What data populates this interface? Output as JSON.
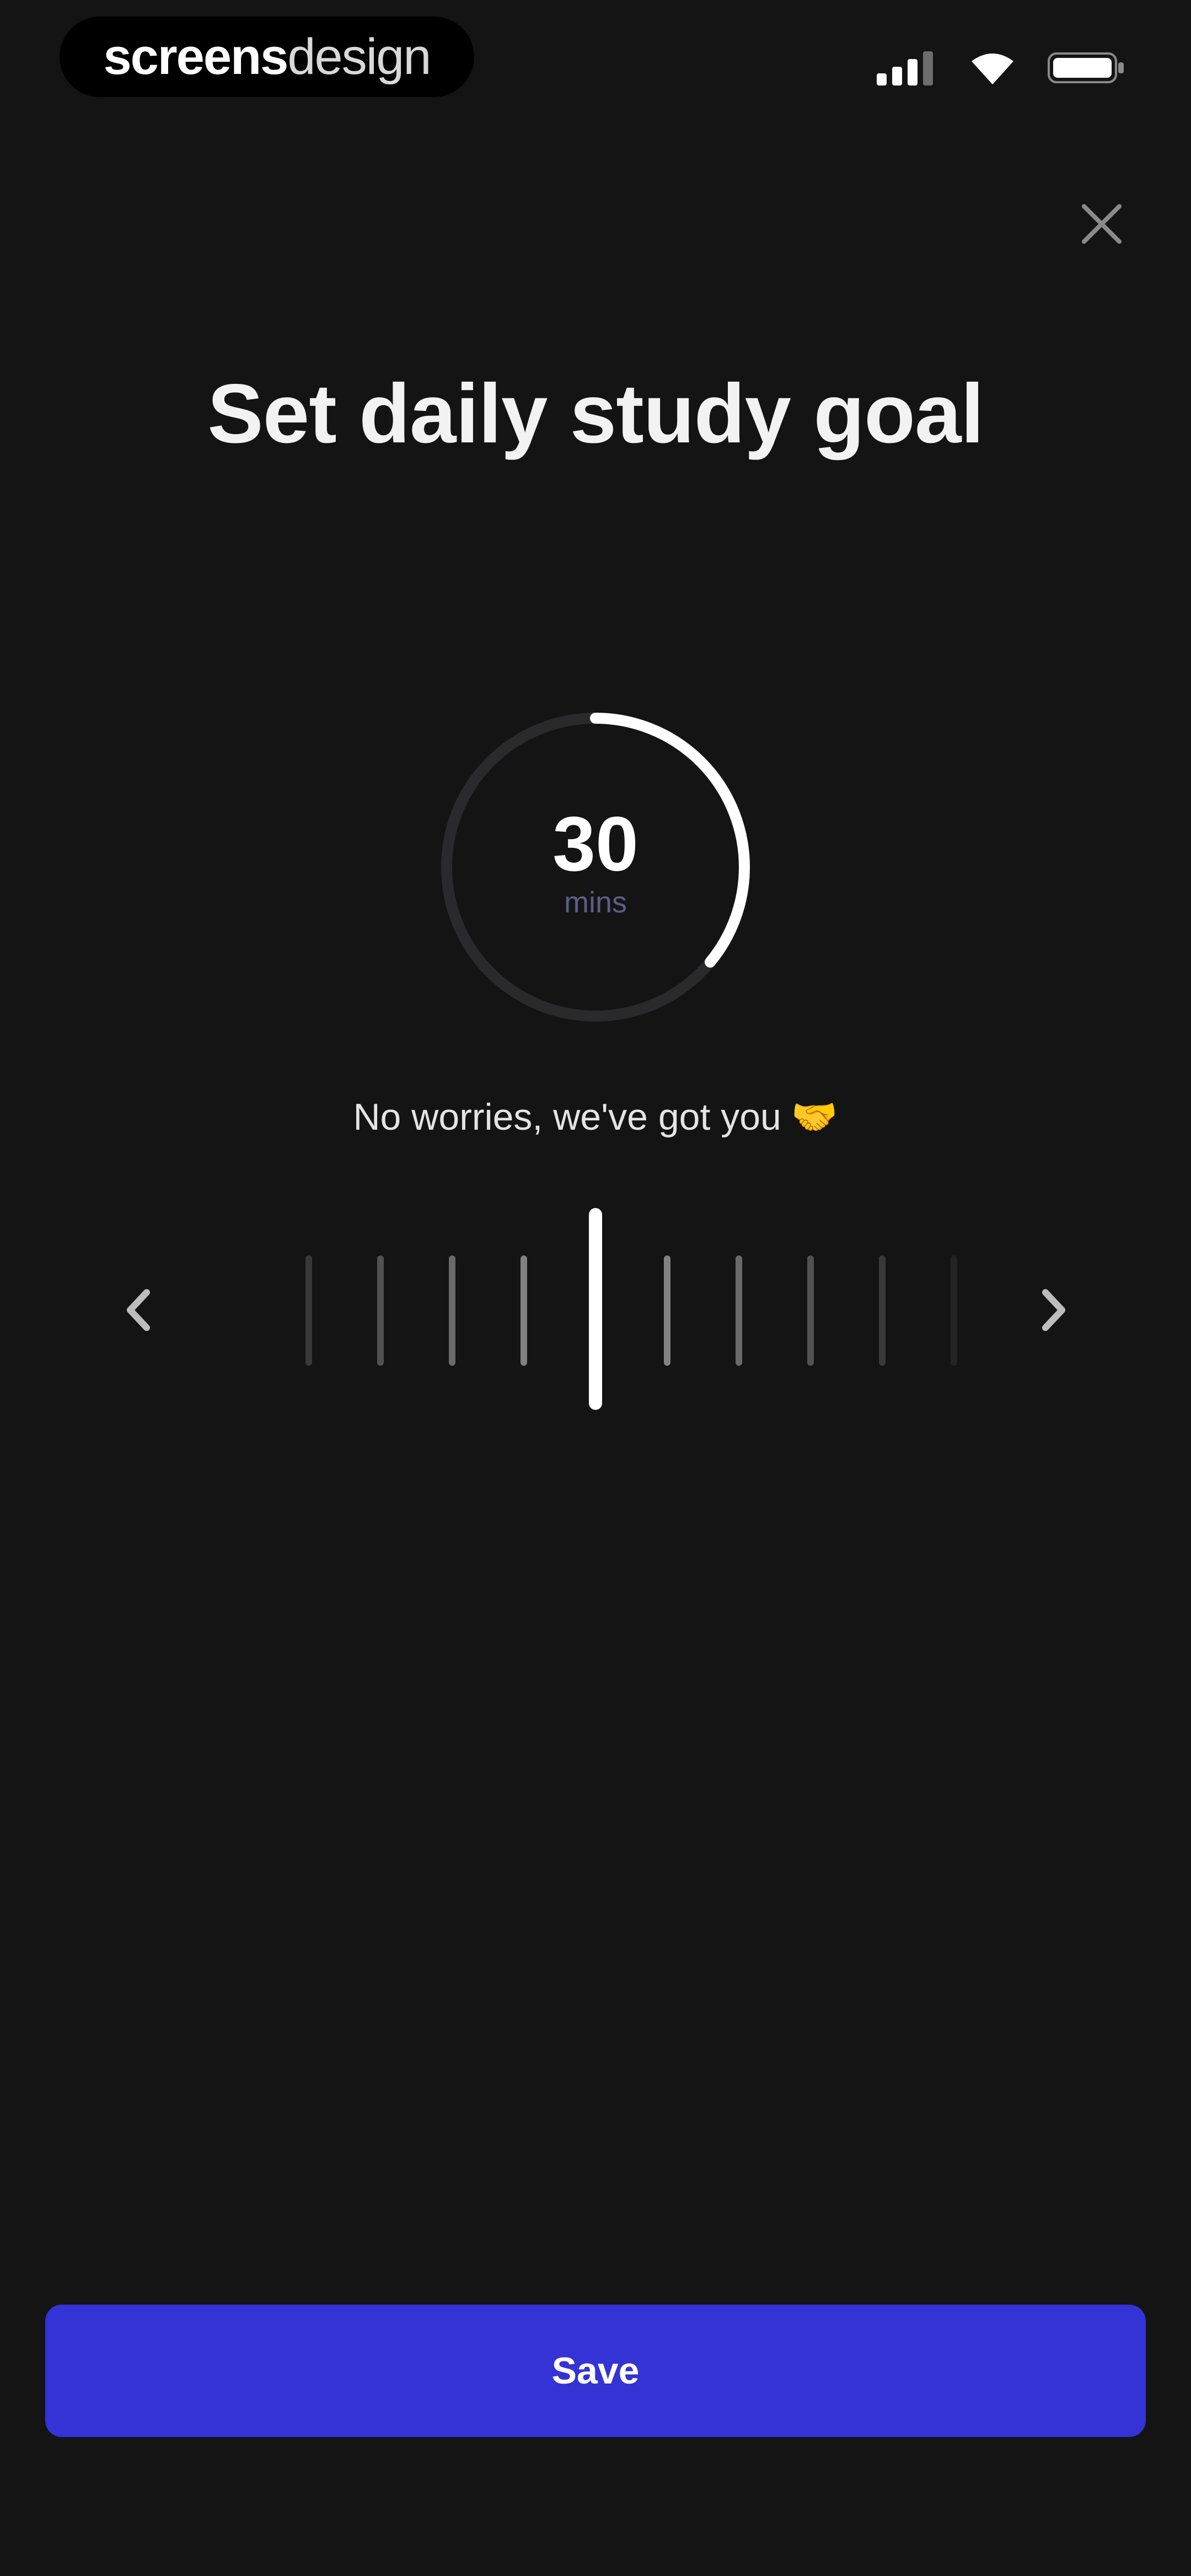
{
  "status_bar": {
    "brand_bold": "screens",
    "brand_light": "design",
    "icons": [
      "signal-icon",
      "wifi-icon",
      "battery-icon"
    ]
  },
  "close": {
    "icon": "close-icon"
  },
  "title": "Set daily study goal",
  "goal": {
    "value": "30",
    "unit": "mins",
    "ring_progress": 0.36
  },
  "message": {
    "text": "No worries, we've got you",
    "emoji": "🤝"
  },
  "picker": {
    "prev_icon": "chevron-left-icon",
    "next_icon": "chevron-right-icon",
    "tick_count": 10,
    "selected_index": 4
  },
  "save_label": "Save",
  "colors": {
    "background": "#141415",
    "accent": "#3333d6",
    "ring_track": "#2a2a2c",
    "ring_fill": "#ffffff"
  }
}
